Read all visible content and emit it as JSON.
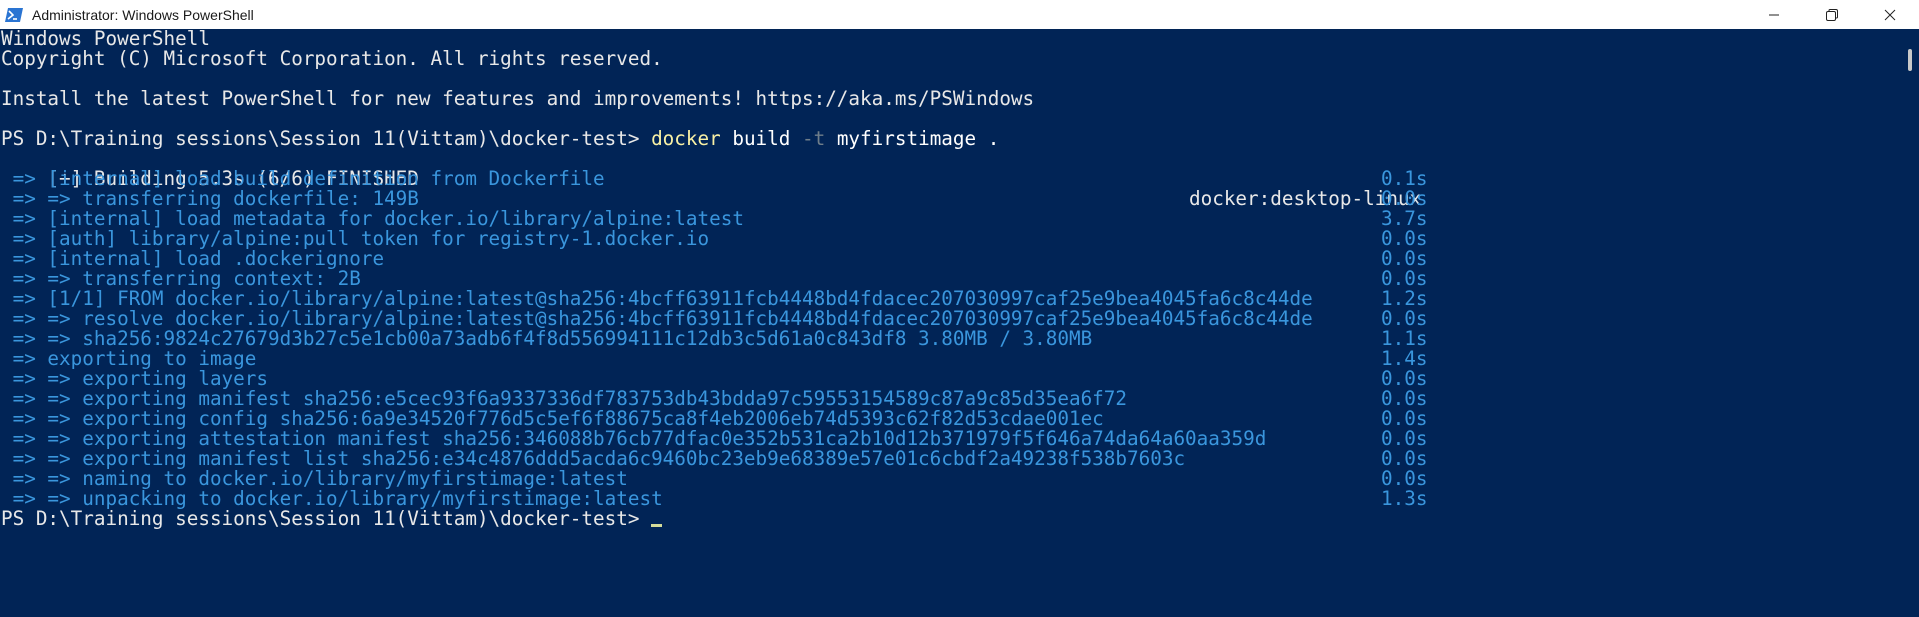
{
  "window": {
    "title": "Administrator: Windows PowerShell",
    "icon": "powershell-icon",
    "caption_buttons": [
      "minimize-icon",
      "restore-icon",
      "close-icon"
    ]
  },
  "colors": {
    "background": "#012456",
    "text": "#e8e8e8",
    "step_text": "#3a96dd",
    "command": "#f9f1a5",
    "parameter": "#6f7e8a"
  },
  "console": {
    "header": [
      "Windows PowerShell",
      "Copyright (C) Microsoft Corporation. All rights reserved.",
      "",
      "Install the latest PowerShell for new features and improvements! https://aka.ms/PSWindows",
      ""
    ],
    "prompt1": {
      "prompt": "PS D:\\Training sessions\\Session 11(Vittam)\\docker-test> ",
      "command": "docker",
      "arg1": " build ",
      "flag": "-t",
      "arg2": " myfirstimage ."
    },
    "build_header": {
      "text": "[+] Building 5.3s (6/6) FINISHED",
      "context": "docker:desktop-linux"
    },
    "steps": [
      {
        "text": " => [internal] load build definition from Dockerfile",
        "time": "0.1s"
      },
      {
        "text": " => => transferring dockerfile: 149B",
        "time": "0.0s"
      },
      {
        "text": " => [internal] load metadata for docker.io/library/alpine:latest",
        "time": "3.7s"
      },
      {
        "text": " => [auth] library/alpine:pull token for registry-1.docker.io",
        "time": "0.0s"
      },
      {
        "text": " => [internal] load .dockerignore",
        "time": "0.0s"
      },
      {
        "text": " => => transferring context: 2B",
        "time": "0.0s"
      },
      {
        "text": " => [1/1] FROM docker.io/library/alpine:latest@sha256:4bcff63911fcb4448bd4fdacec207030997caf25e9bea4045fa6c8c44de",
        "time": "1.2s"
      },
      {
        "text": " => => resolve docker.io/library/alpine:latest@sha256:4bcff63911fcb4448bd4fdacec207030997caf25e9bea4045fa6c8c44de",
        "time": "0.0s"
      },
      {
        "text": " => => sha256:9824c27679d3b27c5e1cb00a73adb6f4f8d556994111c12db3c5d61a0c843df8 3.80MB / 3.80MB",
        "time": "1.1s"
      },
      {
        "text": " => exporting to image",
        "time": "1.4s"
      },
      {
        "text": " => => exporting layers",
        "time": "0.0s"
      },
      {
        "text": " => => exporting manifest sha256:e5cec93f6a9337336df783753db43bdda97c59553154589c87a9c85d35ea6f72",
        "time": "0.0s"
      },
      {
        "text": " => => exporting config sha256:6a9e34520f776d5c5ef6f88675ca8f4eb2006eb74d5393c62f82d53cdae001ec",
        "time": "0.0s"
      },
      {
        "text": " => => exporting attestation manifest sha256:346088b76cb77dfac0e352b531ca2b10d12b371979f5f646a74da64a60aa359d",
        "time": "0.0s"
      },
      {
        "text": " => => exporting manifest list sha256:e34c4876ddd5acda6c9460bc23eb9e68389e57e01c6cbdf2a49238f538b7603c",
        "time": "0.0s"
      },
      {
        "text": " => => naming to docker.io/library/myfirstimage:latest",
        "time": "0.0s"
      },
      {
        "text": " => => unpacking to docker.io/library/myfirstimage:latest",
        "time": "1.3s"
      }
    ],
    "prompt2": {
      "prompt": "PS D:\\Training sessions\\Session 11(Vittam)\\docker-test> "
    }
  }
}
